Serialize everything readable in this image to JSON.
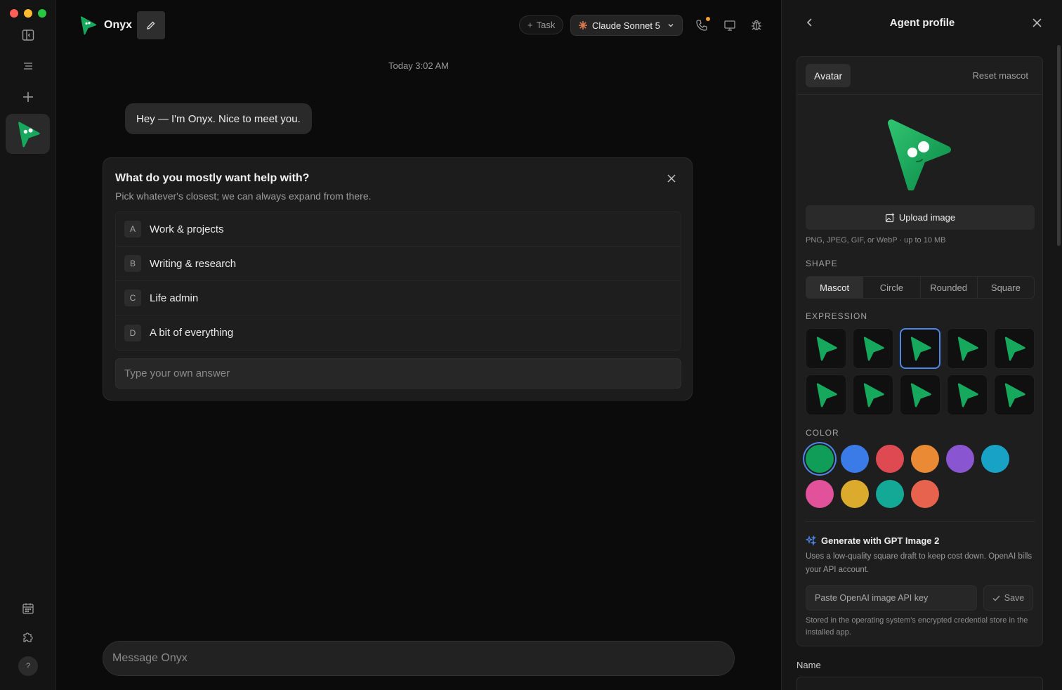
{
  "window": {
    "traffic_colors": [
      "#ff5f57",
      "#febc2e",
      "#28c840"
    ]
  },
  "rail": {
    "toggle_sidebar_icon": "sidebar-icon",
    "menu_icon": "menu-icon",
    "new_icon": "plus-icon",
    "calendar_icon": "calendar-icon",
    "plugins_icon": "puzzle-icon",
    "help_label": "?"
  },
  "header": {
    "agent_name": "Onyx",
    "task_label": "Task",
    "model_label": "Claude Sonnet 5"
  },
  "chat": {
    "timestamp": "Today 3:02 AM",
    "greeting": "Hey — I'm Onyx. Nice to meet you.",
    "question": {
      "title": "What do you mostly want help with?",
      "subtitle": "Pick whatever's closest; we can always expand from there.",
      "options": [
        {
          "key": "A",
          "label": "Work & projects"
        },
        {
          "key": "B",
          "label": "Writing & research"
        },
        {
          "key": "C",
          "label": "Life admin"
        },
        {
          "key": "D",
          "label": "A bit of everything"
        }
      ],
      "own_answer_placeholder": "Type your own answer"
    },
    "composer_placeholder": "Message Onyx"
  },
  "panel": {
    "title": "Agent profile",
    "avatar_tab": "Avatar",
    "reset_label": "Reset mascot",
    "upload_label": "Upload image",
    "upload_hint": "PNG, JPEG, GIF, or WebP · up to 10 MB",
    "shape_label": "SHAPE",
    "shapes": [
      "Mascot",
      "Circle",
      "Rounded",
      "Square"
    ],
    "selected_shape": "Mascot",
    "expression_label": "EXPRESSION",
    "expression_count": 10,
    "selected_expression": 3,
    "color_label": "COLOR",
    "colors": [
      "#0f9d58",
      "#3b7be8",
      "#df4a52",
      "#eb8a35",
      "#8a55d0",
      "#17a2c6",
      "#e2529a",
      "#dcab2e",
      "#14a896",
      "#e8634e"
    ],
    "selected_color": "#0f9d58",
    "generate_title": "Generate with GPT Image 2",
    "generate_desc": "Uses a low-quality square draft to keep cost down. OpenAI bills your API account.",
    "api_placeholder": "Paste OpenAI image API key",
    "save_label": "Save",
    "stored_hint": "Stored in the operating system's encrypted credential store in the installed app.",
    "name_label": "Name"
  }
}
